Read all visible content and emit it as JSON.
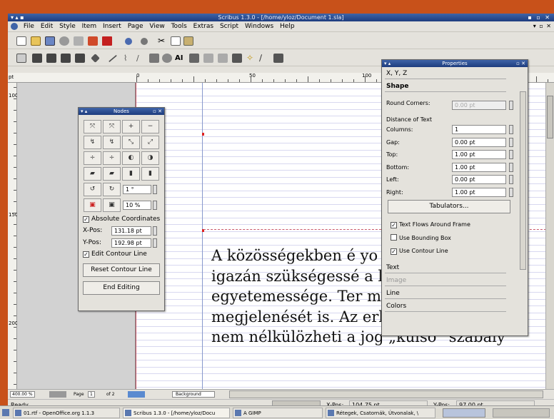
{
  "window": {
    "title": "Scribus 1.3.0 - [/home/yloz/Document 1.sla]"
  },
  "menu": [
    "File",
    "Edit",
    "Style",
    "Item",
    "Insert",
    "Page",
    "View",
    "Tools",
    "Extras",
    "Script",
    "Windows",
    "Help"
  ],
  "ruler": {
    "h_labels": [
      "0",
      "50",
      "100"
    ],
    "v_labels": [
      "100",
      "150",
      "200"
    ],
    "unit": "pt"
  },
  "text_lines": [
    "A közösségekben é             yo",
    "igazán szükségessé a              lás",
    "egyetemessége.  Ter               m",
    "megjelenését is. Az erkölcs a társadal",
    "nem nélkülözheti a jog „külső” szabály"
  ],
  "nodes": {
    "title": "Nodes",
    "rotation": "1 °",
    "scale": "10 %",
    "absolute_label": "Absolute Coordinates",
    "xpos_label": "X-Pos:",
    "xpos_value": "131.18 pt",
    "ypos_label": "Y-Pos:",
    "ypos_value": "192.98 pt",
    "edit_contour_label": "Edit Contour Line",
    "reset_button": "Reset Contour Line",
    "end_button": "End Editing"
  },
  "properties": {
    "title": "Properties",
    "sections_top": [
      "X, Y, Z",
      "Shape"
    ],
    "round_corners_label": "Round Corners:",
    "round_corners_value": "0.00 pt",
    "distance_label": "Distance of Text",
    "rows": [
      {
        "label": "Columns:",
        "value": "1"
      },
      {
        "label": "Gap:",
        "value": "0.00 pt"
      },
      {
        "label": "Top:",
        "value": "1.00 pt"
      },
      {
        "label": "Bottom:",
        "value": "1.00 pt"
      },
      {
        "label": "Left:",
        "value": "0.00 pt"
      },
      {
        "label": "Right:",
        "value": "1.00 pt"
      }
    ],
    "tabulators": "Tabulators...",
    "flow_label": "Text Flows Around Frame",
    "bbox_label": "Use Bounding Box",
    "contour_label": "Use Contour Line",
    "sections_bottom": [
      "Text",
      "Image",
      "Line",
      "Colors"
    ]
  },
  "hscroll": {
    "zoom": "400.00 %",
    "page": "Page",
    "page_num": "1",
    "of": "of 2",
    "layer": "Background"
  },
  "status": {
    "ready": "Ready",
    "xpos_label": "X-Pos:",
    "xpos_value": "104.75 pt",
    "ypos_label": "Y-Pos:",
    "ypos_value": "97.00 pt"
  },
  "taskbar": [
    "01.rtf - OpenOffice.org 1.1.3",
    "Scribus 1.3.0 - [/home/yloz/Docu",
    "A GIMP",
    "Rétegek, Csatornák, Útvonalak, \\"
  ]
}
